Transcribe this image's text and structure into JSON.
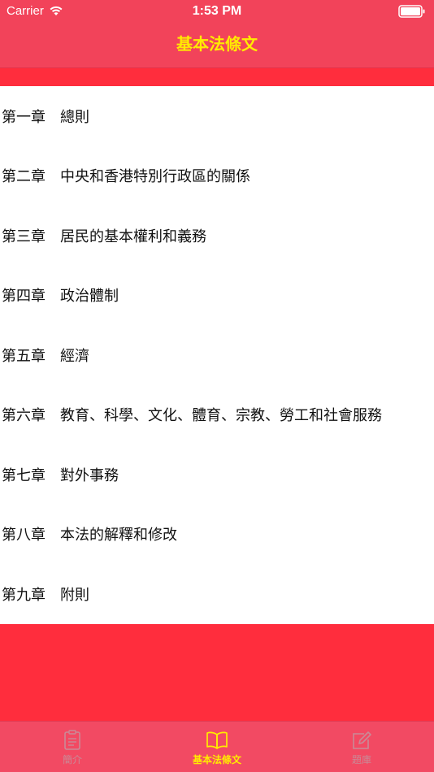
{
  "status_bar": {
    "carrier": "Carrier",
    "time": "1:53 PM"
  },
  "nav": {
    "title": "基本法條文"
  },
  "chapters": [
    {
      "number": "第一章",
      "title": "總則"
    },
    {
      "number": "第二章",
      "title": "中央和香港特別行政區的關係"
    },
    {
      "number": "第三章",
      "title": "居民的基本權利和義務"
    },
    {
      "number": "第四章",
      "title": "政治體制"
    },
    {
      "number": "第五章",
      "title": "經濟"
    },
    {
      "number": "第六章",
      "title": "教育、科學、文化、體育、宗教、勞工和社會服務"
    },
    {
      "number": "第七章",
      "title": "對外事務"
    },
    {
      "number": "第八章",
      "title": "本法的解釋和修改"
    },
    {
      "number": "第九章",
      "title": "附則"
    }
  ],
  "tabbar": {
    "tabs": [
      {
        "label": "簡介",
        "icon": "clipboard-icon",
        "active": false
      },
      {
        "label": "基本法條文",
        "icon": "book-icon",
        "active": true
      },
      {
        "label": "題庫",
        "icon": "edit-icon",
        "active": false
      }
    ]
  },
  "colors": {
    "nav_background": "#f2435a",
    "page_background": "#ff2d3d",
    "title_yellow": "#ffeb00",
    "tab_inactive": "#c98a97"
  }
}
